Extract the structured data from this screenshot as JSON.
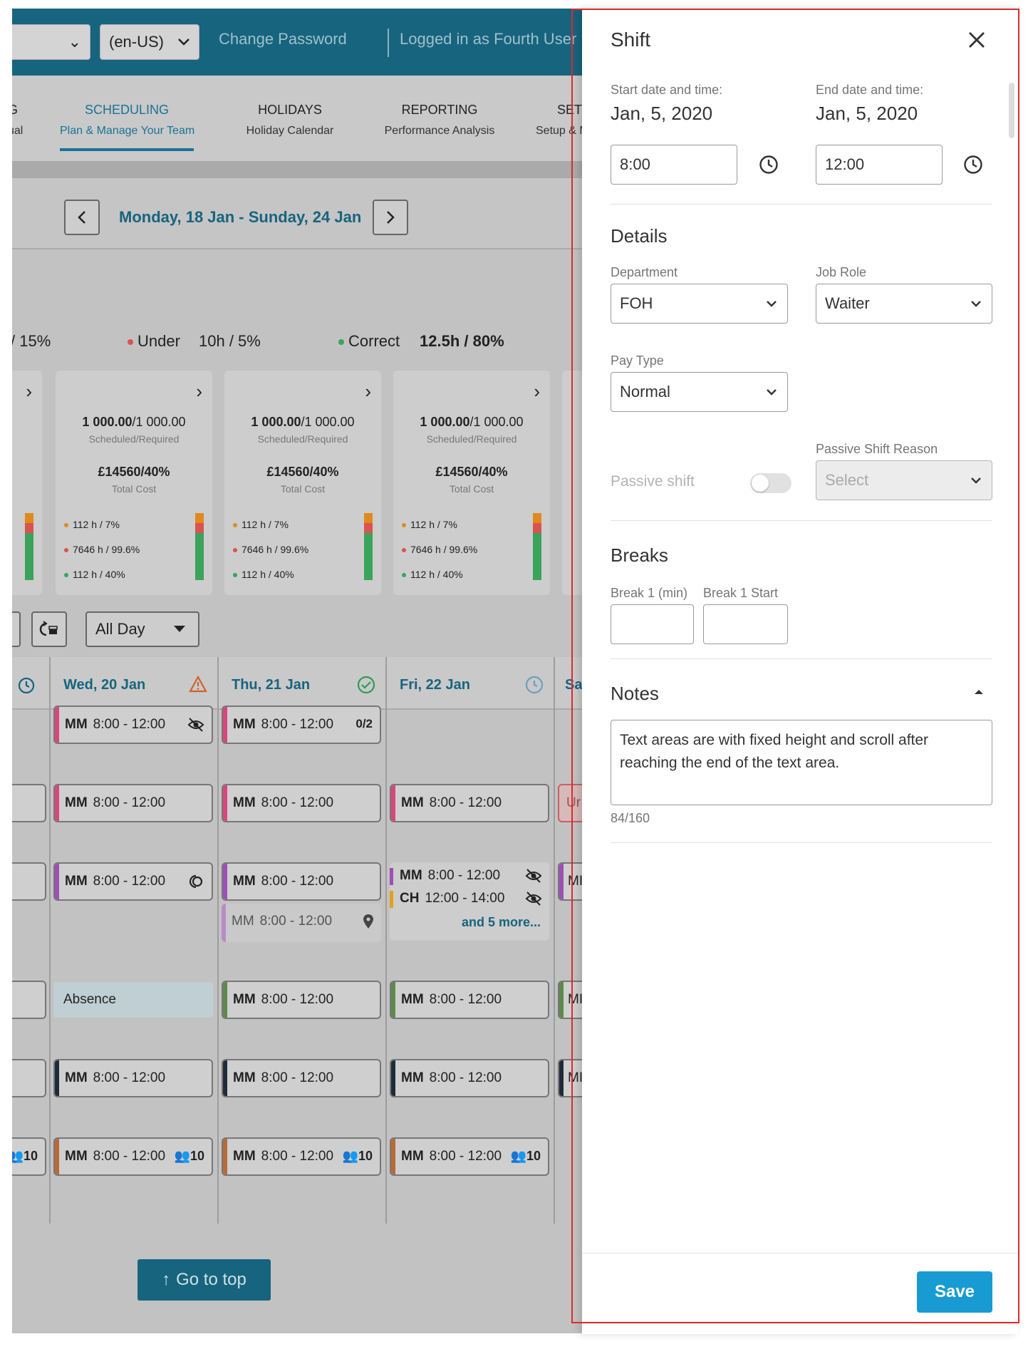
{
  "topbar": {
    "locale": "(en-US)",
    "change_password": "Change Password",
    "logged_in": "Logged in as Fourth User"
  },
  "nav": {
    "items": [
      {
        "title": "G",
        "subtitle": "ual"
      },
      {
        "title": "SCHEDULING",
        "subtitle": "Plan & Manage Your Team"
      },
      {
        "title": "HOLIDAYS",
        "subtitle": "Holiday Calendar"
      },
      {
        "title": "REPORTING",
        "subtitle": "Performance Analysis"
      },
      {
        "title": "SET",
        "subtitle": "Setup & M"
      }
    ]
  },
  "week": {
    "title": "Monday, 18 Jan - Sunday, 24 Jan",
    "prev": "‹",
    "next": "›"
  },
  "stats": {
    "over_value": "/ 15%",
    "under_label": "Under",
    "under_value": "10h / 5%",
    "correct_label": "Correct",
    "correct_value": "12.5h / 80%",
    "colors": {
      "under": "#d9534f",
      "correct": "#3aa35c",
      "over": "#e08a1e"
    }
  },
  "cards": [
    {
      "main": "1 000.00",
      "main_rest": "/1 000.00",
      "main_sub": "Scheduled/Required",
      "cost": "£14560/40%",
      "cost_sub": "Total Cost",
      "l1": "112 h / 7%",
      "l2": "7646 h / 99.6%",
      "l3": "112 h / 40%"
    },
    {
      "main": "1 000.00",
      "main_rest": "/1 000.00",
      "main_sub": "Scheduled/Required",
      "cost": "£14560/40%",
      "cost_sub": "Total Cost",
      "l1": "112 h / 7%",
      "l2": "7646 h / 99.6%",
      "l3": "112 h / 40%"
    },
    {
      "main": "1 000.00",
      "main_rest": "/1 000.00",
      "main_sub": "Scheduled/Required",
      "cost": "£14560/40%",
      "cost_sub": "Total Cost",
      "l1": "112 h / 7%",
      "l2": "7646 h / 99.6%",
      "l3": "112 h / 40%"
    }
  ],
  "filter": {
    "period": "All Day"
  },
  "days": [
    {
      "label": "Wed, 20 Jan"
    },
    {
      "label": "Thu, 21 Jan"
    },
    {
      "label": "Fri, 22 Jan"
    },
    {
      "label": "Sa"
    }
  ],
  "shifts": {
    "code": "MM",
    "time": "8:00 - 12:00",
    "ch_code": "CH",
    "ch_time": "12:00 - 14:00",
    "counter": "0/2",
    "more": "and 5 more...",
    "absence": "Absence",
    "people_count": "10",
    "cut_un": "Ur",
    "cut_mi": "MI"
  },
  "goto_top": "Go to top",
  "panel": {
    "title": "Shift",
    "start_label": "Start date and time:",
    "start_date": "Jan, 5,  2020",
    "start_time": "8:00",
    "end_label": "End date and time:",
    "end_date": "Jan, 5,  2020",
    "end_time": "12:00",
    "details": "Details",
    "department_label": "Department",
    "department_value": "FOH",
    "job_role_label": "Job Role",
    "job_role_value": "Waiter",
    "pay_type_label": "Pay Type",
    "pay_type_value": "Normal",
    "passive_shift_label": "Passive shift",
    "passive_reason_label": "Passive Shift Reason",
    "passive_reason_placeholder": "Select",
    "breaks": "Breaks",
    "break1_min": "Break 1 (min)",
    "break1_start": "Break 1 Start",
    "notes": "Notes",
    "notes_text": "Text areas are with fixed height and scroll after reaching the end of the text area.",
    "notes_count": "84/160",
    "save": "Save"
  }
}
